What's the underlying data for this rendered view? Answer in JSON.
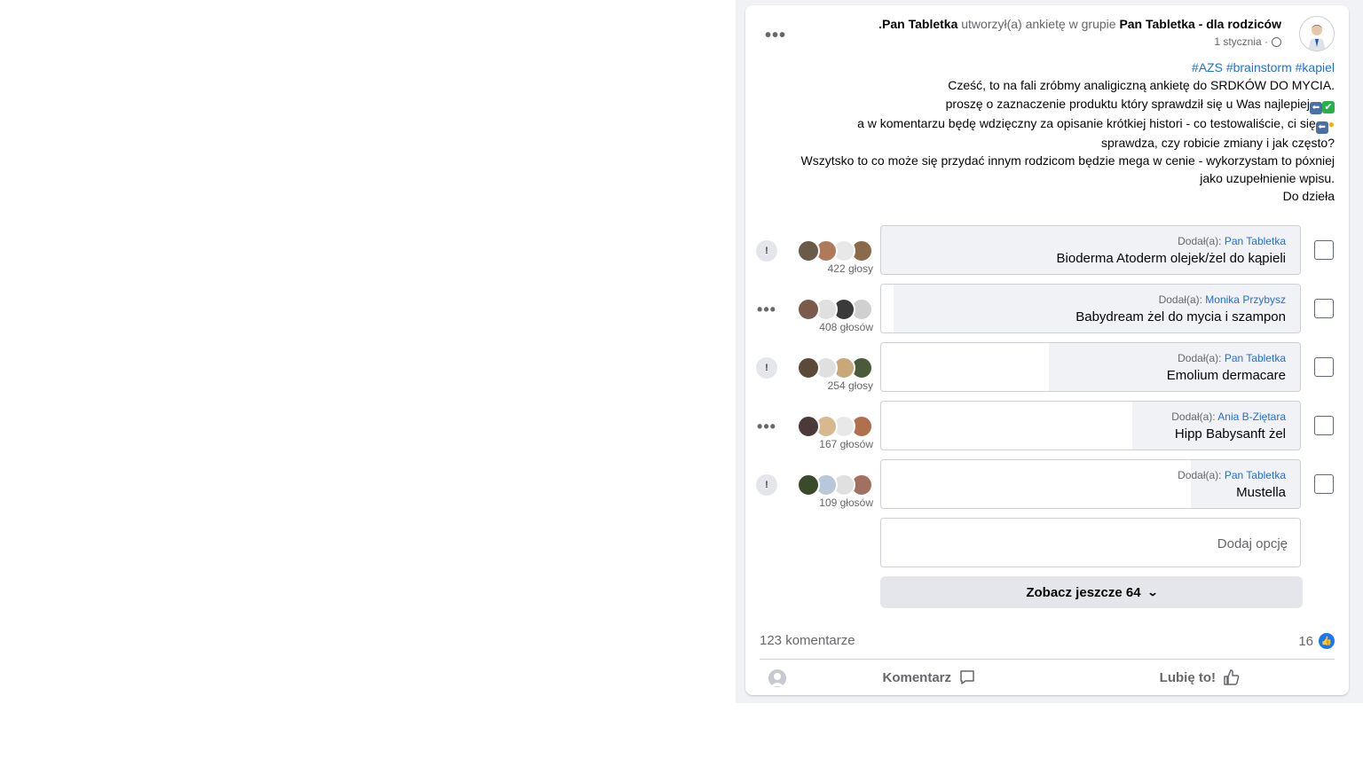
{
  "post": {
    "author": "Pan Tabletka",
    "action_text": "utworzył(a) ankietę w grupie",
    "group": "Pan Tabletka - dla rodziców.",
    "date": "1 stycznia ·",
    "hashtags": "#AZS #brainstorm #kapiel",
    "lines": [
      "Cześć, to na fali zróbmy analigiczną ankietę do SRDKÓW DO MYCIA.",
      "proszę o zaznaczenie produktu który sprawdził się u Was najlepiej",
      "a w komentarzu będę wdzięczny za opisanie krótkiej histori - co testowaliście, ci się",
      "sprawdza, czy robicie zmiany i jak często?",
      "Wszytsko to co może się przydać innym rodzicom będzie mega w cenie - wykorzystam to póxniej",
      "jako uzupełnienie wpisu.",
      "Do dzieła"
    ]
  },
  "poll": {
    "added_prefix": "Dodał(a):",
    "options": [
      {
        "added_by": "Pan Tabletka",
        "label": "Bioderma Atoderm olejek/żel do kąpieli",
        "votes": "422 głosy",
        "fraction": 1.0,
        "action": "info-icon"
      },
      {
        "added_by": "Monika Przybysz",
        "label": "Babydream żel do mycia i szampon",
        "votes": "408 głosów",
        "fraction": 0.97,
        "action": "more-icon"
      },
      {
        "added_by": "Pan Tabletka",
        "label": "Emolium dermacare",
        "votes": "254 głosy",
        "fraction": 0.6,
        "action": "info-icon"
      },
      {
        "added_by": "Ania B-Ziętara",
        "label": "Hipp Babysanft żel",
        "votes": "167 głosów",
        "fraction": 0.4,
        "action": "more-icon"
      },
      {
        "added_by": "Pan Tabletka",
        "label": "Mustella",
        "votes": "109 głosów",
        "fraction": 0.26,
        "action": "info-icon"
      }
    ],
    "add_option_placeholder": "Dodaj opcję",
    "see_more": "Zobacz jeszcze 64"
  },
  "footer": {
    "likes": "16",
    "comments": "123 komentarze",
    "like_button": "Lubię to!",
    "comment_button": "Komentarz"
  },
  "colors": {
    "link": "#216fdb",
    "like_badge": "#1877f2",
    "panel_bg": "#f0f2f5"
  }
}
